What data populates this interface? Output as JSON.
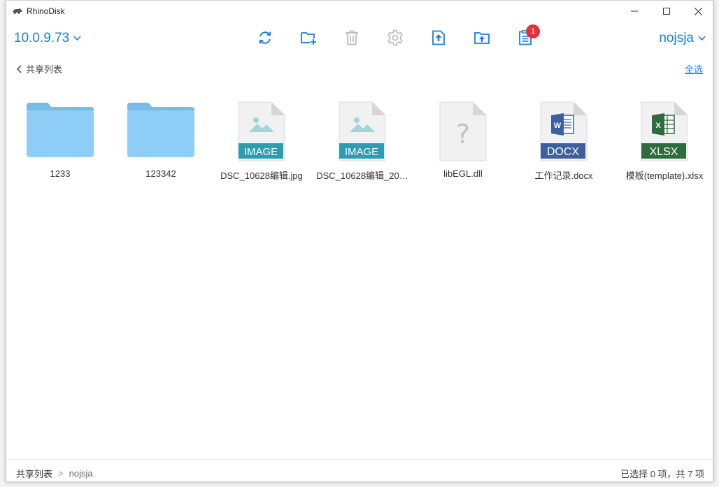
{
  "app": {
    "title": "RhinoDisk"
  },
  "toolbar": {
    "server": "10.0.9.73",
    "user": "nojsja",
    "tasks_badge": "1",
    "icons": [
      "refresh-icon",
      "new-folder-icon",
      "delete-icon",
      "settings-icon",
      "upload-file-icon",
      "upload-folder-icon",
      "task-list-icon"
    ]
  },
  "nav": {
    "back_label": "共享列表",
    "select_all": "全选"
  },
  "files": [
    {
      "name": "1233",
      "type": "folder"
    },
    {
      "name": "123342",
      "type": "folder"
    },
    {
      "name": "DSC_10628编辑.jpg",
      "type": "image",
      "badge": "IMAGE"
    },
    {
      "name": "DSC_10628编辑_20…",
      "type": "image",
      "badge": "IMAGE"
    },
    {
      "name": "libEGL.dll",
      "type": "unknown"
    },
    {
      "name": "工作记录.docx",
      "type": "docx",
      "badge": "DOCX"
    },
    {
      "name": "模板(template).xlsx",
      "type": "xlsx",
      "badge": "XLSX"
    }
  ],
  "statusbar": {
    "breadcrumb": [
      "共享列表",
      "nojsja"
    ],
    "separator": ">",
    "count": "已选择 0 项，共 7 项"
  },
  "colors": {
    "accent": "#1a7ee0",
    "folder": "#8ecdf5",
    "image_badge": "#2f9bb0",
    "docx_badge": "#3d5f9e",
    "xlsx_badge": "#2e6b3e",
    "badge_red": "#e0323a"
  }
}
